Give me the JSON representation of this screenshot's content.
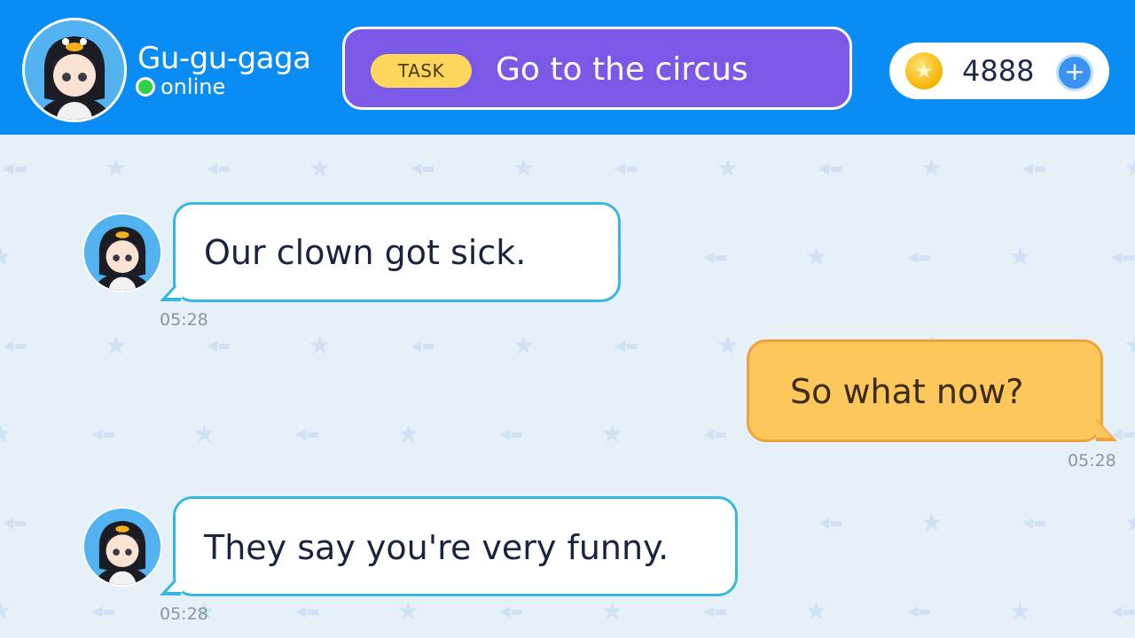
{
  "contact": {
    "name": "Gu-gu-gaga",
    "status": "online",
    "status_color": "#2fcf4a",
    "avatar_icon": "penguin-hood-girl-avatar"
  },
  "task": {
    "badge": "TASK",
    "text": "Go to the circus"
  },
  "wallet": {
    "coins": "4888",
    "coin_icon": "gold-star-coin-icon",
    "add_label": "+"
  },
  "messages": [
    {
      "sender": "contact",
      "text": "Our clown got sick.",
      "time": "05:28"
    },
    {
      "sender": "me",
      "text": "So what now?",
      "time": "05:28"
    },
    {
      "sender": "contact",
      "text": "They say you're very funny.",
      "time": "05:28"
    }
  ],
  "colors": {
    "header_bg": "#0a8cf5",
    "task_bg": "#7b58e6",
    "task_badge": "#fdd65b",
    "chat_bg": "#e6f0f9",
    "incoming_border": "#36b8e0",
    "outgoing_bg": "#fdc75c"
  }
}
